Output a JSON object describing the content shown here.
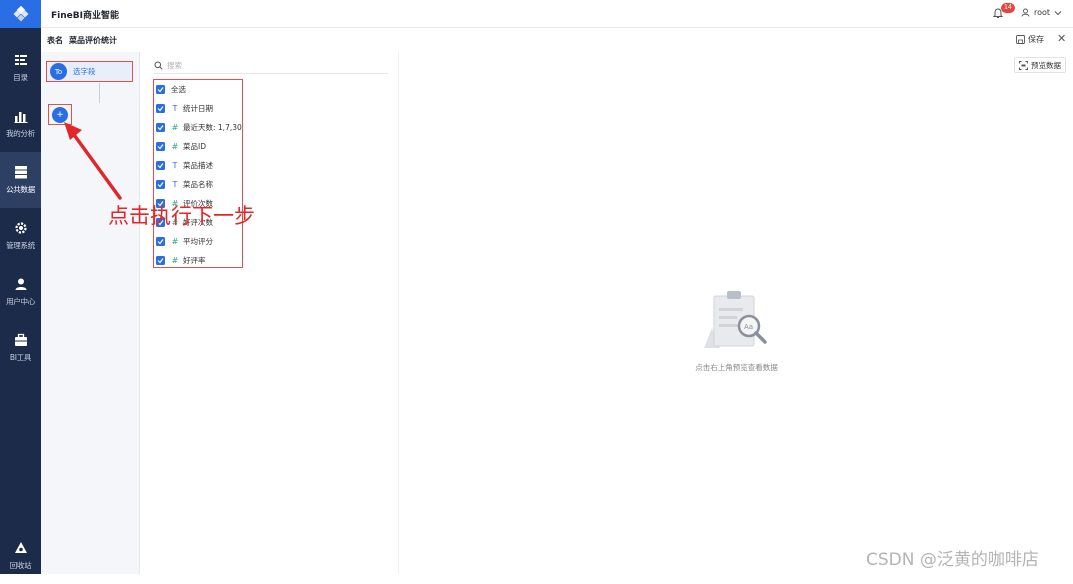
{
  "app": {
    "title": "FineBI商业智能"
  },
  "header": {
    "notification_count": "14",
    "user_name": "root"
  },
  "sidebar": {
    "items": [
      {
        "label": "目录",
        "icon": "catalog-icon"
      },
      {
        "label": "我的分析",
        "icon": "chart-icon"
      },
      {
        "label": "公共数据",
        "icon": "database-icon",
        "active": true
      },
      {
        "label": "管理系统",
        "icon": "gear-icon"
      },
      {
        "label": "用户中心",
        "icon": "user-icon"
      },
      {
        "label": "BI工具",
        "icon": "toolbox-icon"
      },
      {
        "label": "回收站",
        "icon": "recycle-icon"
      }
    ]
  },
  "subbar": {
    "table_label": "表名",
    "table_name": "菜品评价统计",
    "save_label": "保存"
  },
  "flow": {
    "node_icon_text": "To",
    "node_label": "选字段",
    "add_symbol": "+"
  },
  "fields": {
    "search_placeholder": "搜索",
    "select_all": "全选",
    "items": [
      {
        "type_icon": "T",
        "type": "text",
        "name": "统计日期"
      },
      {
        "type_icon": "#",
        "type": "number",
        "name": "最近天数: 1,7,30"
      },
      {
        "type_icon": "#",
        "type": "number",
        "name": "菜品ID"
      },
      {
        "type_icon": "T",
        "type": "text",
        "name": "菜品描述"
      },
      {
        "type_icon": "T",
        "type": "text",
        "name": "菜品名称"
      },
      {
        "type_icon": "#",
        "type": "number",
        "name": "评价次数"
      },
      {
        "type_icon": "#",
        "type": "number",
        "name": "好评次数"
      },
      {
        "type_icon": "#",
        "type": "number",
        "name": "平均评分"
      },
      {
        "type_icon": "#",
        "type": "number",
        "name": "好评率"
      }
    ]
  },
  "preview": {
    "button_label": "预览数据",
    "empty_text": "点击右上角预览查看数据"
  },
  "annotation": {
    "text": "点击执行下一步"
  },
  "watermark": {
    "text": "CSDN @泛黄的咖啡店"
  },
  "colors": {
    "sidebar": "#1c2b4a",
    "accent": "#2a6ee6",
    "highlight": "#e05050",
    "badge": "#e8443a"
  }
}
